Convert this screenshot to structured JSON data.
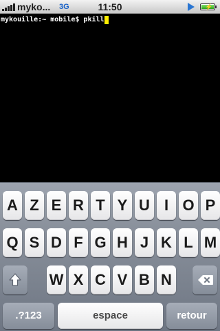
{
  "status_bar": {
    "carrier": "myko...",
    "network": "3G",
    "time": "11:50",
    "icons": [
      "signal-bars-icon",
      "play-icon",
      "battery-charging-icon"
    ]
  },
  "terminal": {
    "prompt": "mykouille:~ mobile$ ",
    "command": "pkill",
    "cursor_color": "#ffee00"
  },
  "keyboard": {
    "row1": [
      "A",
      "Z",
      "E",
      "R",
      "T",
      "Y",
      "U",
      "I",
      "O",
      "P"
    ],
    "row2": [
      "Q",
      "S",
      "D",
      "F",
      "G",
      "H",
      "J",
      "K",
      "L",
      "M"
    ],
    "row3": [
      "W",
      "X",
      "C",
      "V",
      "B",
      "N"
    ],
    "numbers_label": ".?123",
    "space_label": "espace",
    "return_label": "retour"
  }
}
